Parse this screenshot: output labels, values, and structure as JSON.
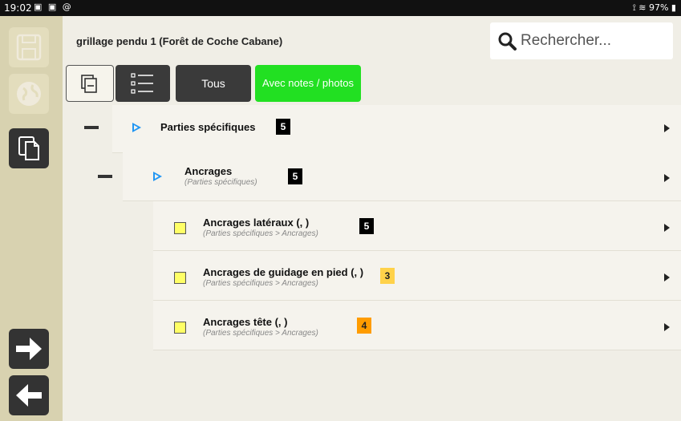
{
  "statusbar": {
    "time": "19:02",
    "left_icons": "▣ ▣ @",
    "right": "⟟ ≋ 97% ▮"
  },
  "sidebar": {
    "buttons": [
      {
        "name": "save-icon",
        "state": "disabled"
      },
      {
        "name": "globe-icon",
        "state": "disabled"
      },
      {
        "name": "copy-icon",
        "state": "active"
      },
      {
        "name": "arrow-right-icon",
        "state": "active"
      },
      {
        "name": "arrow-left-icon",
        "state": "active"
      }
    ]
  },
  "header": {
    "title": "grillage pendu 1 (Forêt de Coche Cabane)"
  },
  "search": {
    "placeholder": "Rechercher..."
  },
  "toolbar": {
    "collapse_icon": "collapse-all-icon",
    "list_icon": "list-icon",
    "all_label": "Tous",
    "with_notes_label": "Avec notes / photos"
  },
  "colors": {
    "accent_green": "#22e022",
    "badge_black": "#000000",
    "badge_yellow": "#ffd24a",
    "badge_orange": "#ff9c00",
    "play_blue": "#2196f3",
    "square_yellow": "#ffff66"
  },
  "rows": [
    {
      "label": "Parties spécifiques",
      "sub": "",
      "count": "5",
      "badge_color": "black"
    },
    {
      "label": "Ancrages",
      "sub": "(Parties spécifiques)",
      "count": "5",
      "badge_color": "black"
    },
    {
      "label": "Ancrages latéraux (, )",
      "sub": "(Parties spécifiques > Ancrages)",
      "count": "5",
      "badge_color": "black"
    },
    {
      "label": "Ancrages de guidage en pied (, )",
      "sub": "(Parties spécifiques > Ancrages)",
      "count": "3",
      "badge_color": "yellow"
    },
    {
      "label": "Ancrages tête (, )",
      "sub": "(Parties spécifiques > Ancrages)",
      "count": "4",
      "badge_color": "orange"
    }
  ]
}
